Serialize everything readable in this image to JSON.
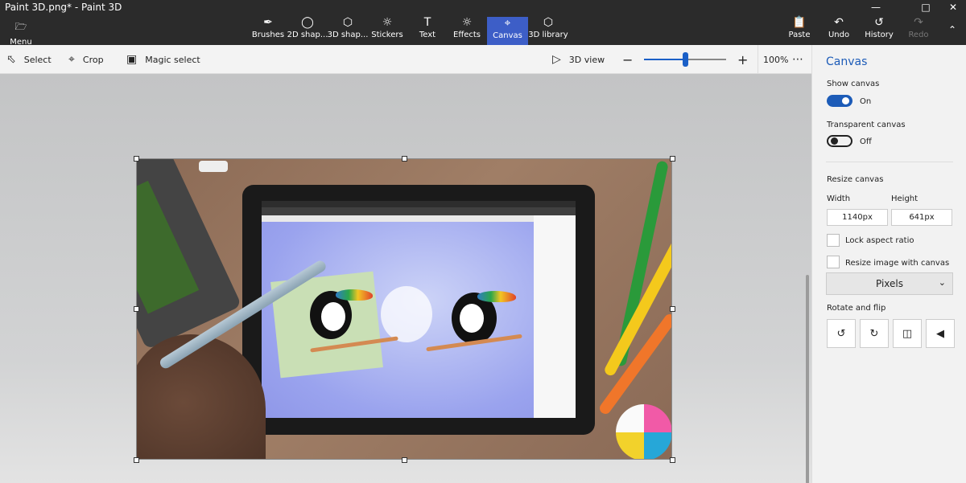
{
  "window": {
    "title": "Paint 3D.png* - Paint 3D",
    "minimize_icon": "minimize-icon",
    "maximize_icon": "maximize-icon",
    "close_icon": "close-icon"
  },
  "ribbon": {
    "menu_label": "Menu",
    "tools": [
      {
        "label": "Brushes",
        "icon": "brush-icon"
      },
      {
        "label": "2D shap...",
        "icon": "2d-shapes-icon"
      },
      {
        "label": "3D shap...",
        "icon": "3d-shapes-icon"
      },
      {
        "label": "Stickers",
        "icon": "sticker-icon"
      },
      {
        "label": "Text",
        "icon": "text-icon"
      },
      {
        "label": "Effects",
        "icon": "sun-icon"
      },
      {
        "label": "Canvas",
        "icon": "canvas-icon",
        "active": true
      },
      {
        "label": "3D library",
        "icon": "3d-library-icon"
      }
    ],
    "paste_label": "Paste",
    "undo_label": "Undo",
    "history_label": "History",
    "redo_label": "Redo",
    "collapse_icon": "chevron-up-icon"
  },
  "toolbar": {
    "select_label": "Select",
    "crop_label": "Crop",
    "magic_select_label": "Magic select",
    "view3d_label": "3D view",
    "zoom_level": "100%",
    "zoom_fraction": 0.5,
    "more_icon": "more-icon"
  },
  "panel": {
    "title": "Canvas",
    "show_canvas_label": "Show canvas",
    "show_canvas_state": "On",
    "transparent_canvas_label": "Transparent canvas",
    "transparent_canvas_state": "Off",
    "resize_canvas_label": "Resize canvas",
    "width_label": "Width",
    "height_label": "Height",
    "width_value": "1140px",
    "height_value": "641px",
    "lock_aspect_label": "Lock aspect ratio",
    "resize_image_label": "Resize image with canvas",
    "units_value": "Pixels",
    "rotate_flip_label": "Rotate and flip"
  },
  "colors": {
    "accent": "#3d5ec7",
    "toggle_on": "#1d5cb8"
  }
}
